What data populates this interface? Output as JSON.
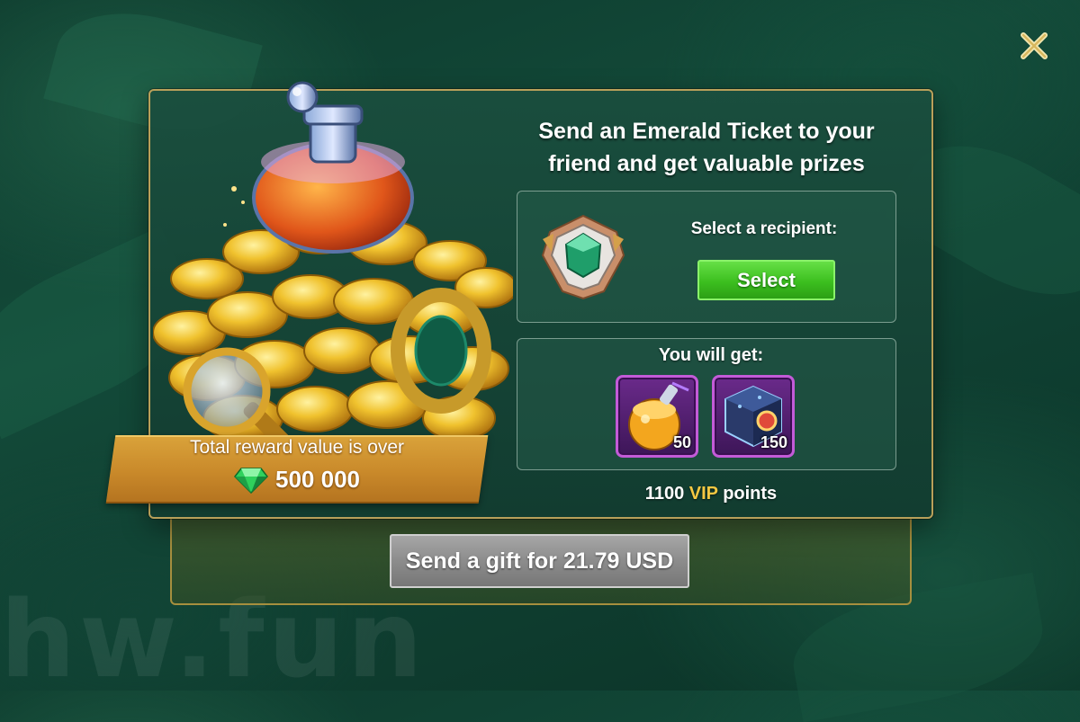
{
  "watermark": "hw.fun",
  "dialog": {
    "title": "Send an Emerald Ticket to your friend and get valuable prizes",
    "reward_banner": {
      "label": "Total reward value is over",
      "amount": "500 000",
      "currency_icon": "emerald-gem-icon"
    },
    "recipient": {
      "label": "Select a recipient:",
      "select_button": "Select",
      "emblem_icon": "emerald-ticket-emblem-icon"
    },
    "rewards": {
      "label": "You will get:",
      "items": [
        {
          "icon": "potion-flask-icon",
          "quantity": "50"
        },
        {
          "icon": "rune-cube-icon",
          "quantity": "150"
        }
      ]
    },
    "vip_points": {
      "amount": "1100",
      "vip_word": "VIP",
      "suffix": "points"
    },
    "send_button": "Send a gift for 21.79 USD"
  },
  "colors": {
    "select_button": "#3cbf1f",
    "send_button": "#8c8c8c",
    "vip_accent": "#f5c842",
    "item_frame": "#c35bd8",
    "border_gold": "#b8a05a"
  }
}
